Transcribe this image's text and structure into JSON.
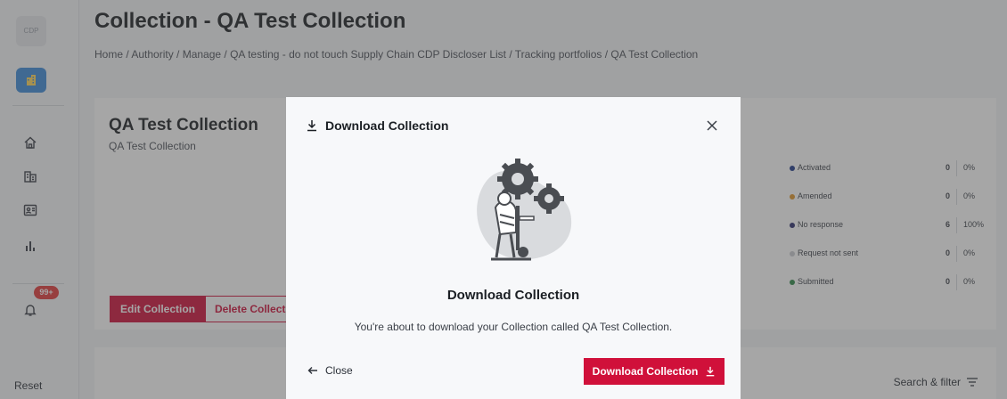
{
  "sidebar": {
    "logo": "CDP",
    "notification_count": "99+",
    "reset_label": "Reset",
    "icons": [
      "building-icon",
      "home-icon",
      "organization-icon",
      "contact-card-icon",
      "bar-chart-icon",
      "bell-icon"
    ]
  },
  "header": {
    "title": "Collection - QA Test Collection",
    "breadcrumb": "Home / Authority / Manage / QA testing - do not touch Supply Chain CDP Discloser List / Tracking portfolios / QA Test Collection"
  },
  "card": {
    "title": "QA Test Collection",
    "subtitle": "QA Test Collection",
    "edit_label": "Edit Collection",
    "delete_label": "Delete Collecti"
  },
  "stats": [
    {
      "label": "Activated",
      "count": "0",
      "pct": "0%",
      "color": "#1f3b8a"
    },
    {
      "label": "Amended",
      "count": "0",
      "pct": "0%",
      "color": "#e0962a"
    },
    {
      "label": "No response",
      "count": "6",
      "pct": "100%",
      "color": "#2c2f6e"
    },
    {
      "label": "Request not sent",
      "count": "0",
      "pct": "0%",
      "color": "#c9ccd2"
    },
    {
      "label": "Submitted",
      "count": "0",
      "pct": "0%",
      "color": "#2e8a4a"
    }
  ],
  "search_filter_label": "Search & filter",
  "modal": {
    "title": "Download Collection",
    "heading": "Download Collection",
    "text": "You're about to download your Collection called QA Test Collection.",
    "close_label": "Close",
    "download_label": "Download Collection"
  },
  "colors": {
    "accent": "#d0103a",
    "sidebar_active": "#3d8bd9",
    "badge": "#e23a3a"
  }
}
